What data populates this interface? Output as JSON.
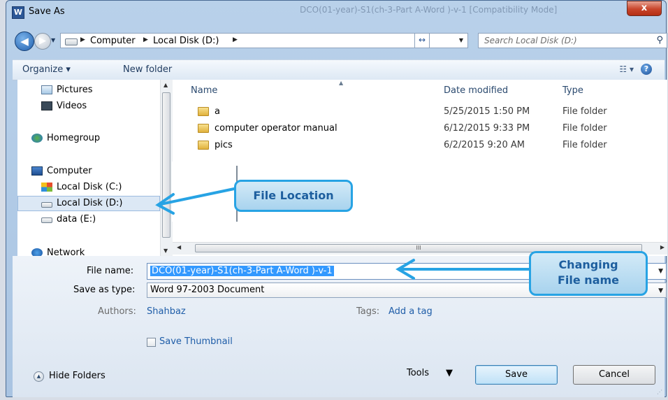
{
  "window": {
    "app_icon_letter": "W",
    "title": "Save As",
    "background_title": "DCO(01-year)-S1(ch-3-Part A-Word )-v-1 [Compatibility Mode]",
    "close_label": "x"
  },
  "address_bar": {
    "segments": [
      "Computer",
      "Local Disk (D:)"
    ],
    "search_placeholder": "Search Local Disk (D:)"
  },
  "toolbar": {
    "organize_label": "Organize ▾",
    "new_folder_label": "New folder"
  },
  "navigation_pane": {
    "items": [
      {
        "label": "Pictures",
        "icon": "pictures-icon"
      },
      {
        "label": "Videos",
        "icon": "videos-icon"
      },
      {
        "label": "Homegroup",
        "icon": "homegroup-icon"
      },
      {
        "label": "Computer",
        "icon": "computer-icon"
      },
      {
        "label": "Local Disk (C:)",
        "icon": "windows-drive-icon"
      },
      {
        "label": "Local Disk (D:)",
        "icon": "drive-icon",
        "selected": true
      },
      {
        "label": "data (E:)",
        "icon": "drive-icon"
      },
      {
        "label": "Network",
        "icon": "network-icon"
      }
    ]
  },
  "file_list": {
    "columns": [
      "Name",
      "Date modified",
      "Type"
    ],
    "rows": [
      {
        "name": "a",
        "date": "5/25/2015 1:50 PM",
        "type": "File folder"
      },
      {
        "name": "computer operator manual",
        "date": "6/12/2015 9:33 PM",
        "type": "File folder"
      },
      {
        "name": "pics",
        "date": "6/2/2015 9:20 AM",
        "type": "File folder"
      }
    ],
    "scroll_grip": "III"
  },
  "form": {
    "file_name_label": "File name:",
    "file_name_value": "DCO(01-year)-S1(ch-3-Part A-Word )-v-1",
    "save_type_label": "Save as type:",
    "save_type_value": "Word 97-2003 Document",
    "authors_label": "Authors:",
    "authors_value": "Shahbaz",
    "tags_label": "Tags:",
    "tags_value": "Add a tag",
    "thumbnail_label": "Save Thumbnail"
  },
  "footer": {
    "hide_folders_label": "Hide Folders",
    "tools_label": "Tools",
    "save_label": "Save",
    "cancel_label": "Cancel"
  },
  "annotations": {
    "file_location": "File Location",
    "changing_file_name_line1": "Changing",
    "changing_file_name_line2": "File name"
  },
  "colors": {
    "callout_border": "#27a3e4",
    "callout_text": "#1d5e9e",
    "selection": "#3399ff"
  }
}
